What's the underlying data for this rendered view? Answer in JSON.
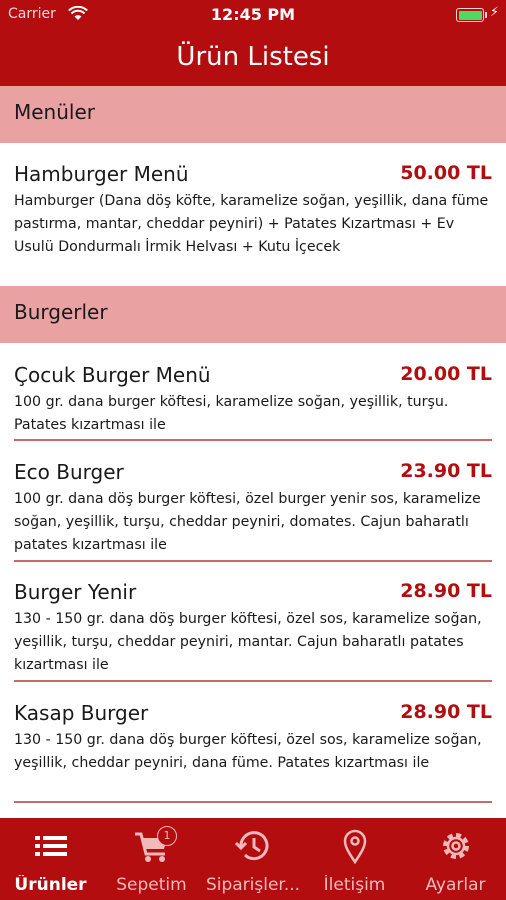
{
  "status_bar": {
    "carrier": "Carrier",
    "time": "12:45 PM"
  },
  "nav": {
    "title": "Ürün Listesi"
  },
  "sections": [
    {
      "title": "Menüler",
      "items": [
        {
          "name": "Hamburger Menü",
          "price": "50.00 TL",
          "description": "Hamburger (Dana döş köfte, karamelize soğan, yeşillik, dana füme pastırma, mantar, cheddar peyniri) + Patates Kızartması + Ev Usulü Dondurmalı İrmik Helvası + Kutu İçecek"
        }
      ]
    },
    {
      "title": "Burgerler",
      "items": [
        {
          "name": "Çocuk Burger Menü",
          "price": "20.00 TL",
          "description": "100 gr. dana burger köftesi, karamelize soğan, yeşillik, turşu. Patates kızartması ile"
        },
        {
          "name": "Eco Burger",
          "price": "23.90 TL",
          "description": "100 gr. dana döş burger köftesi, özel burger yenir sos, karamelize soğan, yeşillik, turşu, cheddar peyniri, domates. Cajun baharatlı patates kızartması ile"
        },
        {
          "name": "Burger Yenir",
          "price": "28.90 TL",
          "description": "130 - 150 gr. dana döş burger köftesi, özel sos, karamelize soğan, yeşillik, turşu, cheddar peyniri, mantar. Cajun baharatlı patates kızartması ile"
        },
        {
          "name": "Kasap Burger",
          "price": "28.90 TL",
          "description": "130 - 150 gr. dana döş burger köftesi, özel sos, karamelize soğan, yeşillik, cheddar peyniri, dana füme. Patates kızartması ile"
        }
      ]
    }
  ],
  "tabs": [
    {
      "label": "Ürünler",
      "icon": "list-icon",
      "active": true
    },
    {
      "label": "Sepetim",
      "icon": "cart-icon",
      "badge": "1"
    },
    {
      "label": "Siparişler...",
      "icon": "history-icon"
    },
    {
      "label": "İletişim",
      "icon": "location-pin-icon"
    },
    {
      "label": "Ayarlar",
      "icon": "gear-icon"
    }
  ],
  "colors": {
    "primary": "#b30d10",
    "section_bg": "#e9a1a2",
    "price": "#b30d10",
    "tab_inactive": "#f0b9ba"
  }
}
